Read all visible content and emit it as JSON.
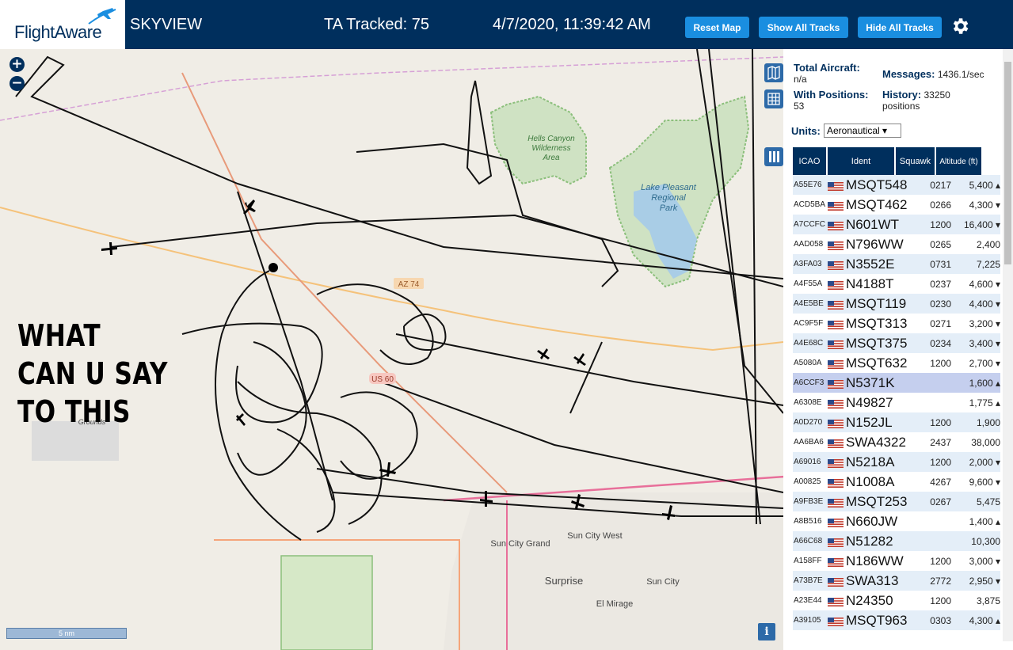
{
  "header": {
    "logo_text": "FlightAware",
    "app_title": "SKYVIEW",
    "tracked_label": "TA Tracked: 75",
    "datetime": "4/7/2020, 11:39:42 AM",
    "buttons": {
      "reset": "Reset Map",
      "show": "Show All Tracks",
      "hide": "Hide All Tracks"
    }
  },
  "map": {
    "overlay_lines": [
      "WHAT",
      "CAN U SAY",
      "TO THIS"
    ],
    "scale_label": "5 nm",
    "place_labels": {
      "hells_canyon": [
        "Hells Canyon",
        "Wilderness",
        "Area"
      ],
      "lake_pleasant": [
        "Lake Pleasant",
        "Regional",
        "Park"
      ],
      "sun_city_grand": "Sun City Grand",
      "sun_city_west": "Sun City West",
      "surprise": "Surprise",
      "sun_city": "Sun City",
      "el_mirage": "El Mirage",
      "az74": "AZ 74",
      "us60": "US 60",
      "grounds": "Grounds"
    },
    "info_label": "i"
  },
  "panel": {
    "total_label": "Total Aircraft:",
    "total_value": "n/a",
    "positions_label": "With Positions:",
    "positions_value": "53",
    "messages_label": "Messages:",
    "messages_value": "1436.1/sec",
    "history_label": "History:",
    "history_value": "33250",
    "history_unit": "positions",
    "units_label": "Units:",
    "units_value": "Aeronautical ▾",
    "columns": [
      "ICAO",
      "Ident",
      "Squawk",
      "Altitude (ft)"
    ],
    "rows": [
      {
        "icao": "A55E76",
        "ident": "MSQT548",
        "squawk": "0217",
        "alt": "5,400 ▴"
      },
      {
        "icao": "ACD5BA",
        "ident": "MSQT462",
        "squawk": "0266",
        "alt": "4,300 ▾"
      },
      {
        "icao": "A7CCFC",
        "ident": "N601WT",
        "squawk": "1200",
        "alt": "16,400 ▾"
      },
      {
        "icao": "AAD058",
        "ident": "N796WW",
        "squawk": "0265",
        "alt": "2,400"
      },
      {
        "icao": "A3FA03",
        "ident": "N3552E",
        "squawk": "0731",
        "alt": "7,225"
      },
      {
        "icao": "A4F55A",
        "ident": "N4188T",
        "squawk": "0237",
        "alt": "4,600 ▾"
      },
      {
        "icao": "A4E5BE",
        "ident": "MSQT119",
        "squawk": "0230",
        "alt": "4,400 ▾"
      },
      {
        "icao": "AC9F5F",
        "ident": "MSQT313",
        "squawk": "0271",
        "alt": "3,200 ▾"
      },
      {
        "icao": "A4E68C",
        "ident": "MSQT375",
        "squawk": "0234",
        "alt": "3,400 ▾"
      },
      {
        "icao": "A5080A",
        "ident": "MSQT632",
        "squawk": "1200",
        "alt": "2,700 ▾"
      },
      {
        "icao": "A6CCF3",
        "ident": "N5371K",
        "squawk": "",
        "alt": "1,600 ▴"
      },
      {
        "icao": "A6308E",
        "ident": "N49827",
        "squawk": "",
        "alt": "1,775 ▴"
      },
      {
        "icao": "A0D270",
        "ident": "N152JL",
        "squawk": "1200",
        "alt": "1,900"
      },
      {
        "icao": "AA6BA6",
        "ident": "SWA4322",
        "squawk": "2437",
        "alt": "38,000"
      },
      {
        "icao": "A69016",
        "ident": "N5218A",
        "squawk": "1200",
        "alt": "2,000 ▾"
      },
      {
        "icao": "A00825",
        "ident": "N1008A",
        "squawk": "4267",
        "alt": "9,600 ▾"
      },
      {
        "icao": "A9FB3E",
        "ident": "MSQT253",
        "squawk": "0267",
        "alt": "5,475"
      },
      {
        "icao": "A8B516",
        "ident": "N660JW",
        "squawk": "",
        "alt": "1,400 ▴"
      },
      {
        "icao": "A66C68",
        "ident": "N51282",
        "squawk": "",
        "alt": "10,300"
      },
      {
        "icao": "A158FF",
        "ident": "N186WW",
        "squawk": "1200",
        "alt": "3,000 ▾"
      },
      {
        "icao": "A73B7E",
        "ident": "SWA313",
        "squawk": "2772",
        "alt": "2,950 ▾"
      },
      {
        "icao": "A23E44",
        "ident": "N24350",
        "squawk": "1200",
        "alt": "3,875"
      },
      {
        "icao": "A39105",
        "ident": "MSQT963",
        "squawk": "0303",
        "alt": "4,300 ▴"
      }
    ]
  }
}
